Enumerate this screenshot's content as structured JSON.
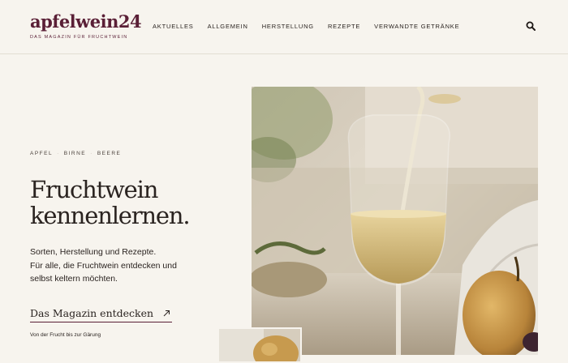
{
  "header": {
    "logo": "apfelwein24",
    "tagline": "DAS MAGAZIN FÜR FRUCHTWEIN",
    "nav": [
      "AKTUELLES",
      "ALLGEMEIN",
      "HERSTELLUNG",
      "REZEPTE",
      "VERWANDTE GETRÄNKE"
    ],
    "search_icon": "search-icon"
  },
  "hero": {
    "eyebrow": [
      "APFEL",
      "BIRNE",
      "BEERE"
    ],
    "eyebrow_separator": "·",
    "headline": [
      "Fruchtwein",
      "kennenlernen."
    ],
    "body": [
      "Sorten, Herstellung und Rezepte.",
      "Für alle, die Fruchtwein entdecken und",
      "selbst keltern möchten."
    ],
    "cta_label": "Das Magazin entdecken",
    "cta_icon": "arrow-up-right-icon",
    "footnote": "Von der Frucht bis zur Gärung"
  },
  "colors": {
    "accent": "#5a1f36",
    "background": "#f7f4ee",
    "text": "#2a2320"
  }
}
